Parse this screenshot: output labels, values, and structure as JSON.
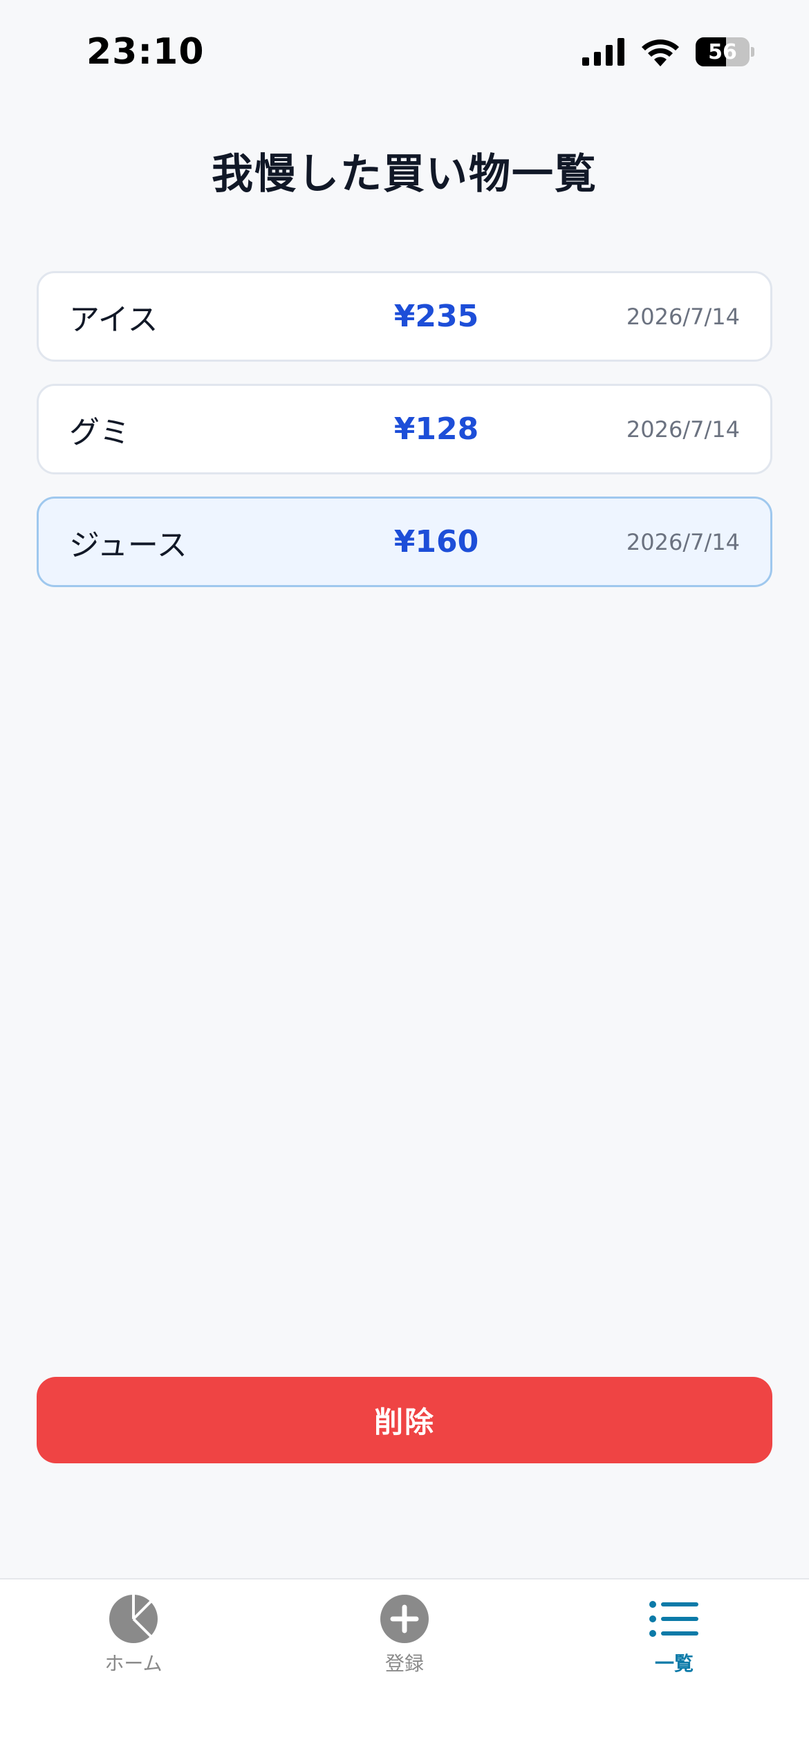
{
  "status_bar": {
    "time": "23:10",
    "battery": "56"
  },
  "page_title": "我慢した買い物一覧",
  "items": [
    {
      "name": "アイス",
      "price": "¥235",
      "date": "2026/7/14",
      "selected": false
    },
    {
      "name": "グミ",
      "price": "¥128",
      "date": "2026/7/14",
      "selected": false
    },
    {
      "name": "ジュース",
      "price": "¥160",
      "date": "2026/7/14",
      "selected": true
    }
  ],
  "delete_label": "削除",
  "tabs": [
    {
      "label": "ホーム",
      "icon": "pie-chart-icon",
      "active": false
    },
    {
      "label": "登録",
      "icon": "plus-circle-icon",
      "active": false
    },
    {
      "label": "一覧",
      "icon": "list-icon",
      "active": true
    }
  ],
  "colors": {
    "accent_blue": "#1d4ed8",
    "delete_red": "#ef4444",
    "tab_active": "#0b7aa8",
    "tab_inactive": "#8a8a8a",
    "selected_bg": "#eef5ff"
  }
}
